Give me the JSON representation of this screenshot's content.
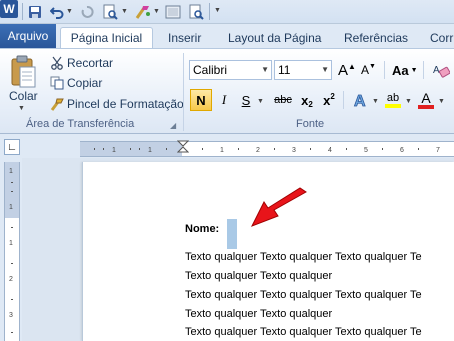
{
  "app": {
    "logo_letter": "W"
  },
  "tabs": {
    "file": "Arquivo",
    "home": "Página Inicial",
    "insert": "Inserir",
    "page_layout": "Layout da Página",
    "references": "Referências",
    "mailings_partial": "Corr"
  },
  "clipboard": {
    "paste": "Colar",
    "cut": "Recortar",
    "copy": "Copiar",
    "format_painter": "Pincel de Formatação",
    "group_label": "Área de Transferência"
  },
  "font": {
    "family": "Calibri",
    "size": "11",
    "group_label": "Fonte",
    "grow_label": "A",
    "shrink_label": "A",
    "case_label": "Aa",
    "bold": "N",
    "italic": "I",
    "underline": "S",
    "strike": "abc",
    "subscript": "x",
    "sub_mark": "2",
    "superscript": "x",
    "super_mark": "2",
    "font_color_label": "A",
    "highlight_label": "ab"
  },
  "document": {
    "lines": [
      "Nome:",
      "Texto qualquer Texto qualquer Texto qualquer Te",
      "Texto qualquer Texto qualquer",
      "Texto qualquer Texto qualquer Texto qualquer Te",
      "Texto qualquer Texto qualquer",
      "Texto qualquer Texto qualquer Texto qualquer Te"
    ]
  },
  "colors": {
    "arrow": "#e8141a",
    "file_tab": "#2a5699",
    "font_color": "#e02020",
    "highlight": "#ffff00"
  }
}
